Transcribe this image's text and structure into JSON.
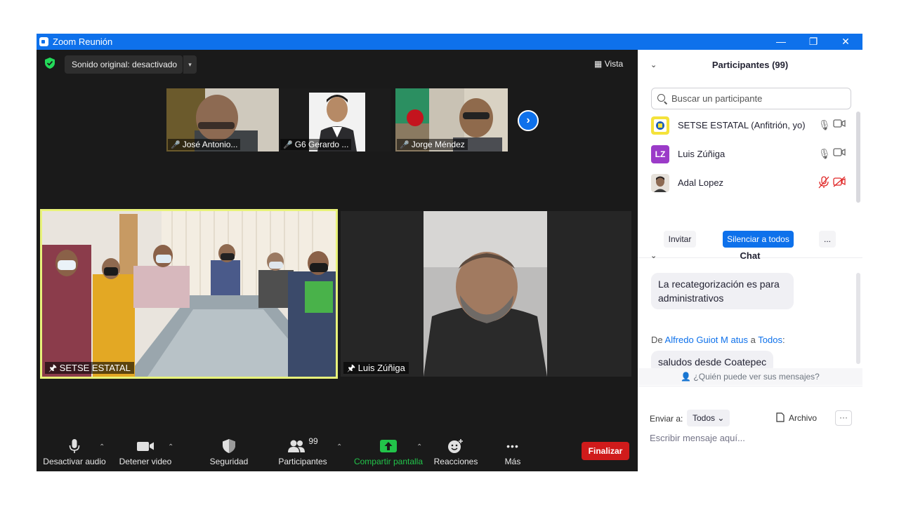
{
  "window": {
    "title": "Zoom Reunión",
    "minimize": "—",
    "restore": "❐",
    "close": "✕"
  },
  "meeting": {
    "sound_button": "Sonido original: desactivado",
    "sound_caret": "▾",
    "view_button": "Vista",
    "view_icon": "▦",
    "thumbnails": [
      {
        "name": "José Antonio..."
      },
      {
        "name": "G6 Gerardo ..."
      },
      {
        "name": "Jorge Méndez"
      }
    ],
    "next_arrow": "›",
    "pin_icon": "🖈",
    "tiles": [
      {
        "name": "SETSE ESTATAL"
      },
      {
        "name": "Luis Zúñiga"
      }
    ]
  },
  "toolbar": {
    "audio": "Desactivar audio",
    "video": "Detener video",
    "security": "Seguridad",
    "participants": "Participantes",
    "participants_count": "99",
    "share": "Compartir pantalla",
    "reactions": "Reacciones",
    "more": "Más",
    "more_icon": "•••",
    "caret": "⌃",
    "end": "Finalizar"
  },
  "panel": {
    "collapse_icon": "⌄",
    "participants_title": "Participantes (99)",
    "search_placeholder": "Buscar un participante",
    "participants": [
      {
        "name": "SETSE ESTATAL (Anfitrión, yo)",
        "mic_muted": false,
        "cam_off": false
      },
      {
        "name": "Luis Zúñiga",
        "initials": "LZ",
        "mic_muted": false,
        "cam_off": false
      },
      {
        "name": "Adal Lopez",
        "mic_muted": true,
        "cam_off": true
      }
    ],
    "invite": "Invitar",
    "mute_all": "Silenciar a todos",
    "more_btn": "...",
    "chat_title": "Chat",
    "messages": [
      {
        "text": "La recategorización es para administrativos"
      },
      {
        "prefix": "De",
        "sender": "Alfredo Guiot M atus",
        "to_word": "a",
        "recipient": "Todos",
        "colon": ":",
        "text": "saludos desde Coatepec"
      }
    ],
    "who_sees": "¿Quién puede ver sus mensajes?",
    "send_to_label": "Enviar a:",
    "send_to_value": "Todos",
    "file_label": "Archivo",
    "more_dots": "···",
    "input_placeholder": "Escribir mensaje aquí..."
  },
  "colors": {
    "accent": "#0e71eb",
    "end": "#d01b1b",
    "share": "#22c44a",
    "speaker_border": "#e8f27a"
  }
}
